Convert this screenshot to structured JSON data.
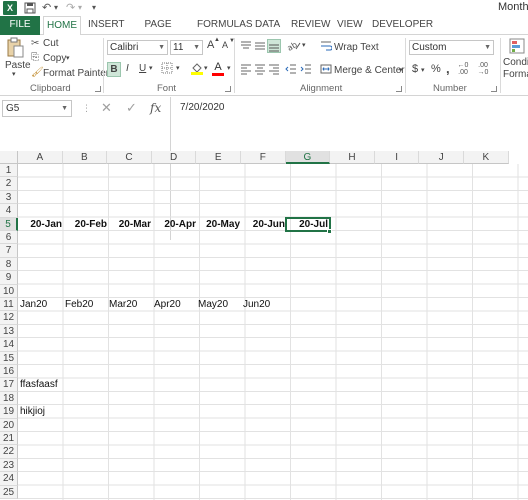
{
  "app": {
    "logo": "X",
    "title": "Month",
    "qat": {
      "undo": "↶",
      "redo": "↷",
      "more": "▾"
    }
  },
  "tabs": [
    {
      "label": "FILE"
    },
    {
      "label": "HOME"
    },
    {
      "label": "INSERT"
    },
    {
      "label": "PAGE LAYOUT"
    },
    {
      "label": "FORMULAS"
    },
    {
      "label": "DATA"
    },
    {
      "label": "REVIEW"
    },
    {
      "label": "VIEW"
    },
    {
      "label": "DEVELOPER"
    }
  ],
  "ribbon": {
    "clipboard": {
      "paste": "Paste",
      "cut": "Cut",
      "copy": "Copy",
      "format_painter": "Format Painter",
      "label": "Clipboard"
    },
    "font": {
      "name": "Calibri",
      "size": "11",
      "bold": "B",
      "italic": "I",
      "underline": "U",
      "grow": "A",
      "shrink": "A",
      "label": "Font"
    },
    "alignment": {
      "wrap_text": "Wrap Text",
      "merge_center": "Merge & Center",
      "label": "Alignment"
    },
    "number": {
      "format": "Custom",
      "currency": "$",
      "percent": "%",
      "comma": ",",
      "label": "Number"
    },
    "styles": {
      "conditional": "Condit",
      "format_as": "Format"
    }
  },
  "formula_bar": {
    "name_box": "G5",
    "cancel": "✕",
    "enter": "✓",
    "fx": "fx",
    "value": "7/20/2020"
  },
  "columns": [
    "A",
    "B",
    "C",
    "D",
    "E",
    "F",
    "G",
    "H",
    "I",
    "J",
    "K"
  ],
  "rows": [
    "1",
    "2",
    "3",
    "4",
    "5",
    "6",
    "7",
    "8",
    "9",
    "10",
    "11",
    "12",
    "13",
    "14",
    "15",
    "16",
    "17",
    "18",
    "19",
    "20",
    "21",
    "22",
    "23",
    "24",
    "25"
  ],
  "row5": [
    "20-Jan",
    "20-Feb",
    "20-Mar",
    "20-Apr",
    "20-May",
    "20-Jun",
    "20-Jul"
  ],
  "row11": [
    "Jan20",
    "Feb20",
    "Mar20",
    "Apr20",
    "May20",
    "Jun20"
  ],
  "a17": "ffasfaasf",
  "a19": "hikjioj"
}
